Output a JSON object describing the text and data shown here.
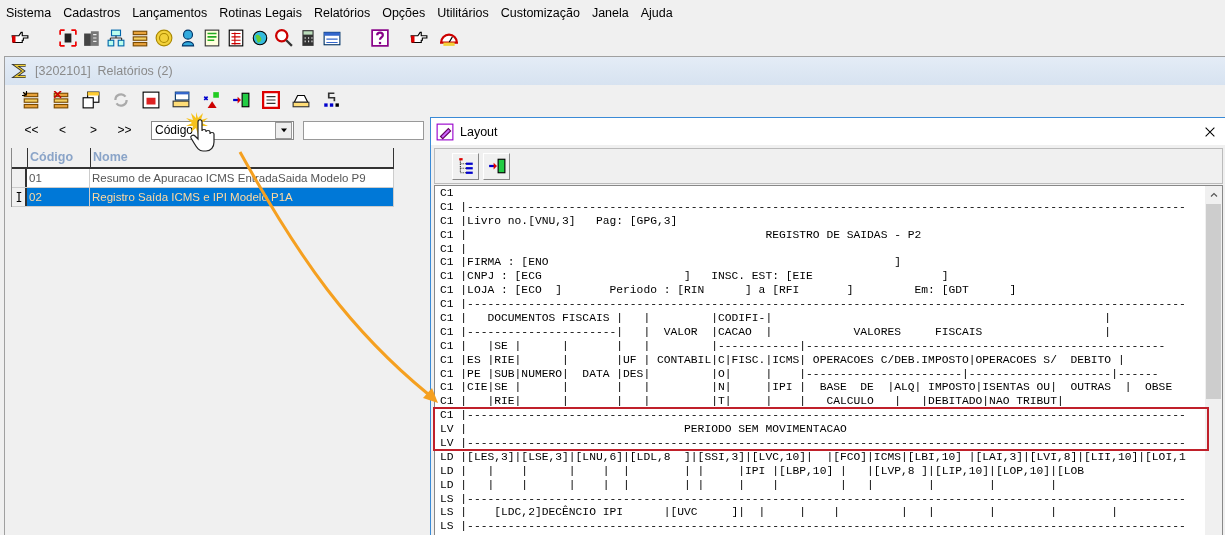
{
  "menu_bar": [
    "Sistema",
    "Cadastros",
    "Lançamentos",
    "Rotinas Legais",
    "Relatórios",
    "Opções",
    "Utilitários",
    "Customização",
    "Janela",
    "Ajuda"
  ],
  "child_window": {
    "title": "[3202101]  Relatórios (2)",
    "navigation": {
      "buttons": [
        "<<",
        "<",
        ">",
        ">>"
      ],
      "sort_field": {
        "value": "Código"
      }
    },
    "grid": {
      "columns": [
        "Código",
        "Nome"
      ],
      "rows": [
        {
          "cells": [
            "01",
            "Resumo de Apuracao ICMS EntradaSaida  Modelo P9"
          ],
          "selected": false
        },
        {
          "cells": [
            "02",
            "Registro Saída ICMS e IPI  Modelo P1A"
          ],
          "selected": true
        }
      ]
    }
  },
  "layout_window": {
    "title": "Layout",
    "lines": [
      "C1",
      "C1 |----------------------------------------------------------------------------------------------------------",
      "C1 |Livro no.[VNU,3]   Pag: [GPG,3]",
      "C1 |                                            REGISTRO DE SAIDAS - P2",
      "C1 |",
      "C1 |FIRMA : [ENO                                                   ]",
      "C1 |CNPJ : [ECG                     ]   INSC. EST: [EIE                   ]",
      "C1 |LOJA : [ECO  ]       Periodo : [RIN      ] a [RFI       ]         Em: [GDT      ]",
      "C1 |----------------------------------------------------------------------------------------------------------",
      "C1 |   DOCUMENTOS FISCAIS |   |         |CODIFI-|                                                 |",
      "C1 |----------------------|   |  VALOR  |CACAO  |            VALORES     FISCAIS                  |",
      "C1 |   |SE |      |       |   |         |------------|-----------------------------------------------------",
      "C1 |ES |RIE|      |       |UF | CONTABIL|C|FISC.|ICMS| OPERACOES C/DEB.IMPOSTO|OPERACOES S/  DEBITO |",
      "C1 |PE |SUB|NUMERO|  DATA |DES|         |O|     |    |-----------------------|---------------------|------",
      "C1 |CIE|SE |      |       |   |         |N|     |IPI |  BASE  DE  |ALQ| IMPOSTO|ISENTAS OU|  OUTRAS  |  OBSE",
      "C1 |   |RIE|      |       |   |         |T|     |    |   CALCULO   |   |DEBITADO|NAO TRIBUT|",
      "C1 |----------------------------------------------------------------------------------------------------------",
      "LV |                                PERIODO SEM MOVIMENTACAO",
      "LV |----------------------------------------------------------------------------------------------------------",
      "LD |[LES,3]|[LSE,3]|[LNU,6]|[LDL,8  ]|[SSI,3]|[LVC,10]|  |[FCO]|ICMS|[LBI,10] |[LAI,3]|[LVI,8]|[LII,10]|[LOI,1",
      "LD |   |    |      |    |  |        | |     |IPI |[LBP,10] |   |[LVP,8 ]|[LIP,10]|[LOP,10]|[LOB",
      "LD |   |    |      |    |  |        | |     |    |         |   |        |        |        |",
      "LS |----------------------------------------------------------------------------------------------------------",
      "LS |    [LDC,2]DECÊNCIO IPI      |[UVC     ]|  |     |    |         |   |        |        |        |",
      "LS |----------------------------------------------------------------------------------------------------------"
    ]
  }
}
